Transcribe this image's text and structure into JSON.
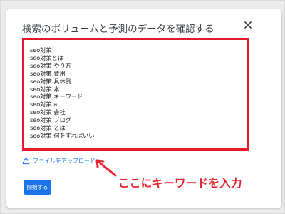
{
  "dialog": {
    "title": "検索のボリュームと予測のデータを確認する",
    "close_icon": "close-icon"
  },
  "keywords": [
    "seo対策",
    "seo対策とは",
    "seo対策 やり方",
    "seo対策 費用",
    "seo対策 具体例",
    "seo対策 本",
    "seo対策 キーワード",
    "seo対策 ai",
    "seo対策 会社",
    "seo対策 ブログ",
    "seo対策 とは",
    "seo対策 何をすればいい"
  ],
  "upload": {
    "label": "ファイルをアップロード",
    "icon": "upload-icon"
  },
  "start_button": {
    "label": "開始する"
  },
  "annotation": {
    "text": "ここにキーワードを入力",
    "icon": "arrow-icon"
  },
  "colors": {
    "accent": "#1a73e8",
    "annotation": "#e8242f",
    "highlight_border": "#e5192a"
  }
}
